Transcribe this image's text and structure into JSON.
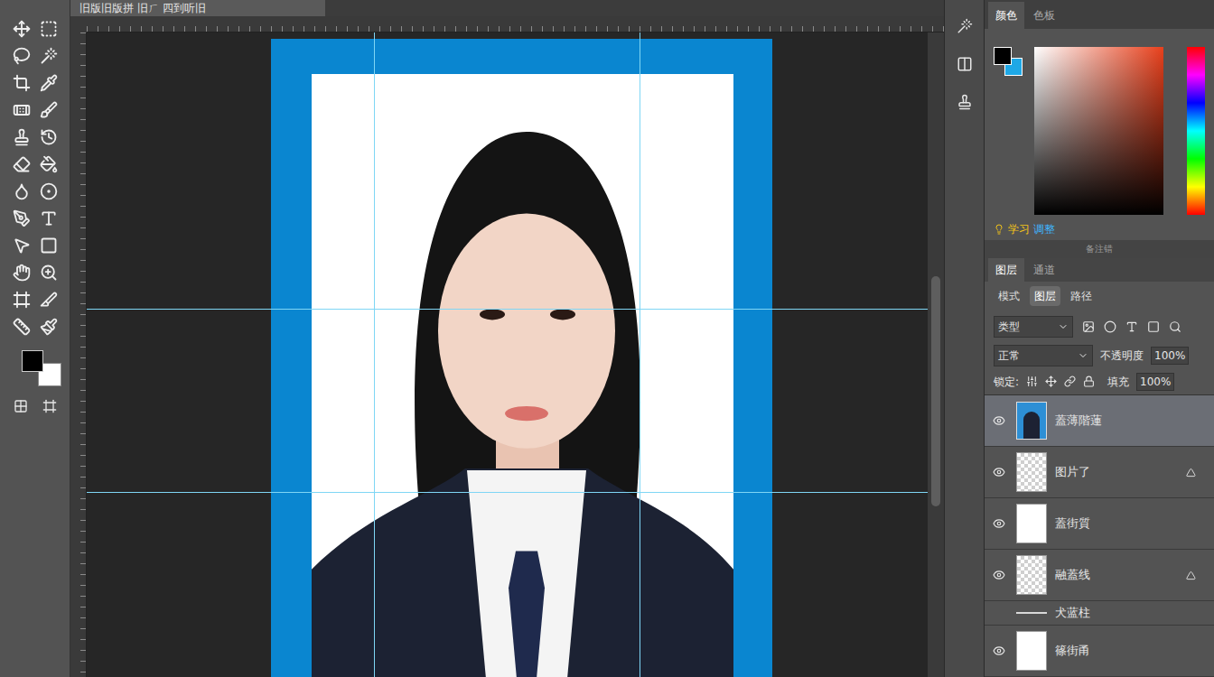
{
  "window": {
    "title": "旧版旧版拼 旧ㄏ 四到听旧"
  },
  "color_panel": {
    "tabs": [
      {
        "label": "颜色",
        "selected": true
      },
      {
        "label": "色板",
        "selected": false
      }
    ]
  },
  "learn_bar": {
    "label": "学习",
    "link": "调整"
  },
  "panel_strip": {
    "label": "备注错"
  },
  "layers_panel": {
    "tabs": [
      {
        "label": "图层",
        "selected": true
      },
      {
        "label": "通道",
        "selected": false
      }
    ],
    "view_tabs": [
      {
        "label": "模式",
        "selected": false
      },
      {
        "label": "图层",
        "selected": true
      },
      {
        "label": "路径",
        "selected": false
      }
    ],
    "filter": {
      "value": "类型"
    },
    "blend": {
      "value": "正常",
      "opacity_label": "不透明度",
      "opacity": "100%"
    },
    "lock": {
      "label": "锁定:",
      "fill_label": "填充",
      "fill": "100%"
    },
    "layers": [
      {
        "name": "蓋薄階蓮",
        "kind": "photo",
        "visible": true,
        "selected": true,
        "masked": false
      },
      {
        "name": "图片了",
        "kind": "transparent",
        "visible": true,
        "selected": false,
        "masked": true
      },
      {
        "name": "蓋街質",
        "kind": "white",
        "visible": true,
        "selected": false,
        "masked": false
      },
      {
        "name": "融蓋线",
        "kind": "transparent",
        "visible": true,
        "selected": false,
        "masked": true
      },
      {
        "name": "犬蓝柱",
        "kind": "line",
        "visible": false,
        "selected": false,
        "masked": false
      },
      {
        "name": "篠街甬",
        "kind": "white",
        "visible": true,
        "selected": false,
        "masked": false
      }
    ]
  }
}
